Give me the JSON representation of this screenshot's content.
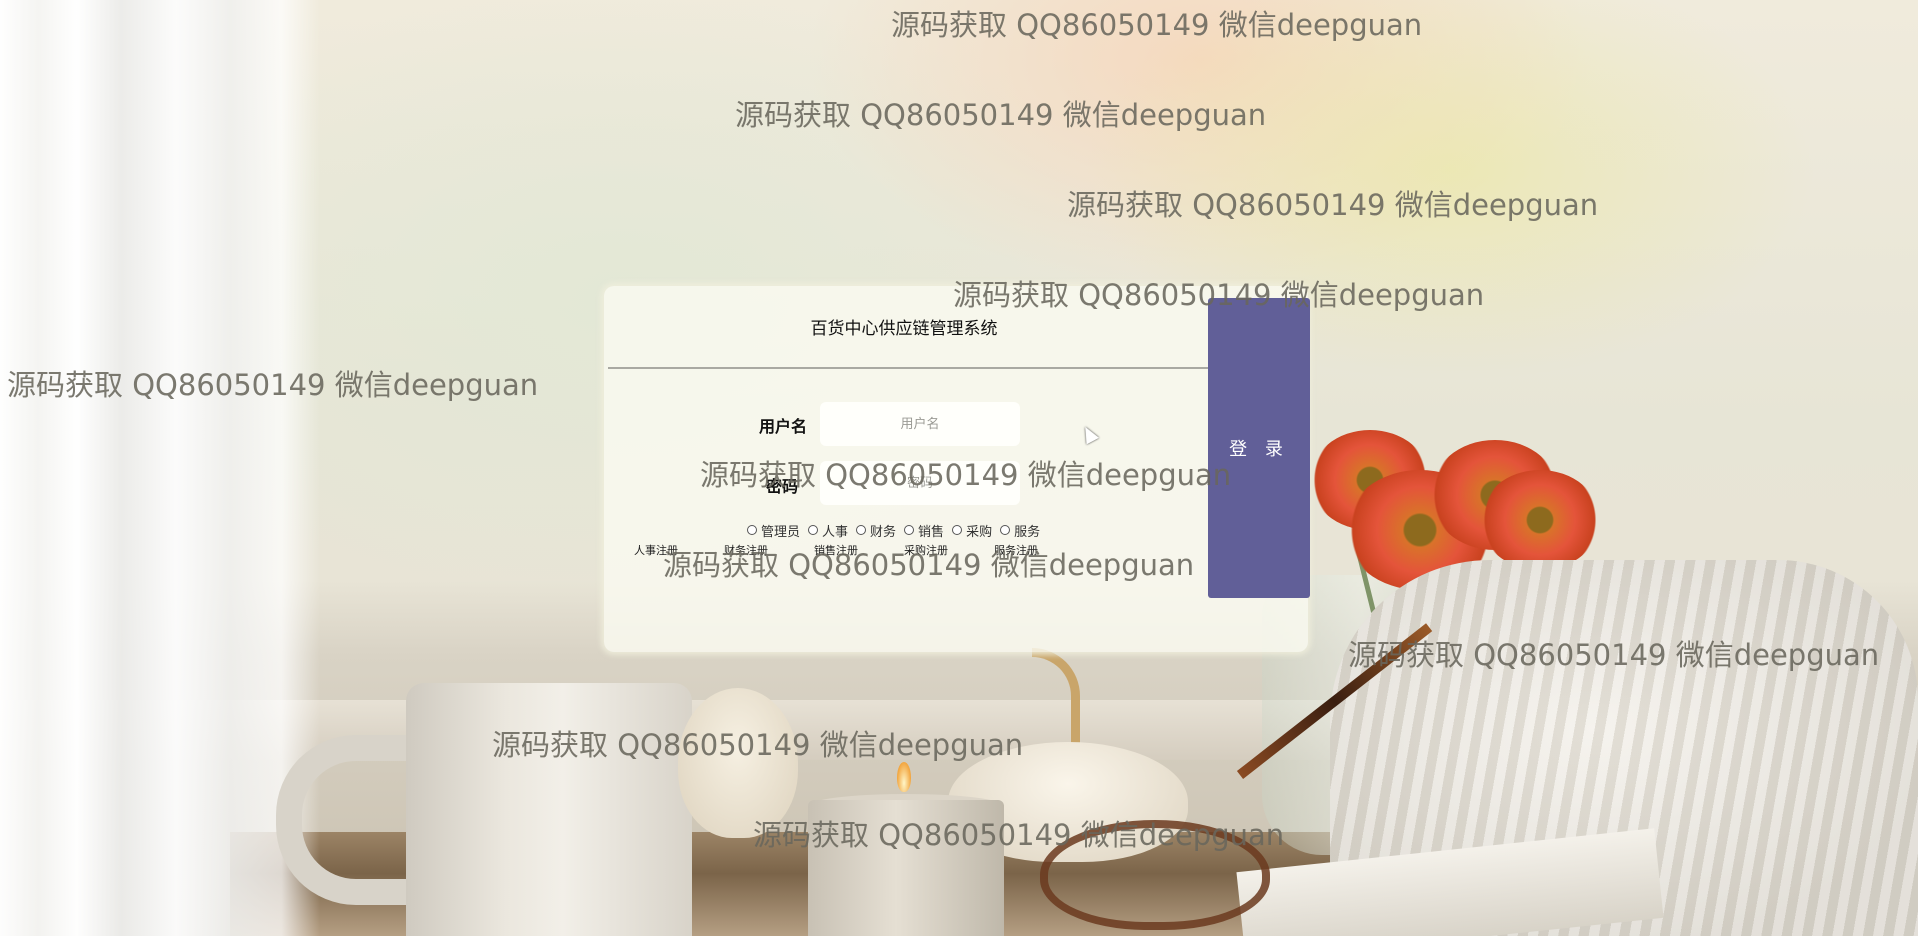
{
  "app": {
    "title": "百货中心供应链管理系统"
  },
  "form": {
    "username_label": "用户名",
    "username_placeholder": "用户名",
    "username_value": "",
    "password_label": "密码",
    "password_placeholder": "密码",
    "password_value": ""
  },
  "roles": [
    {
      "label": "管理员",
      "selected": false
    },
    {
      "label": "人事",
      "selected": false
    },
    {
      "label": "财务",
      "selected": false
    },
    {
      "label": "销售",
      "selected": false
    },
    {
      "label": "采购",
      "selected": false
    },
    {
      "label": "服务",
      "selected": false
    }
  ],
  "register_links": [
    "人事注册",
    "财务注册",
    "销售注册",
    "采购注册",
    "服务注册"
  ],
  "login_button": "登 录",
  "watermark": "源码获取 QQ86050149 微信deepguan",
  "colors": {
    "login_button_bg": "#615f98",
    "card_bg": "#fafaf0"
  }
}
